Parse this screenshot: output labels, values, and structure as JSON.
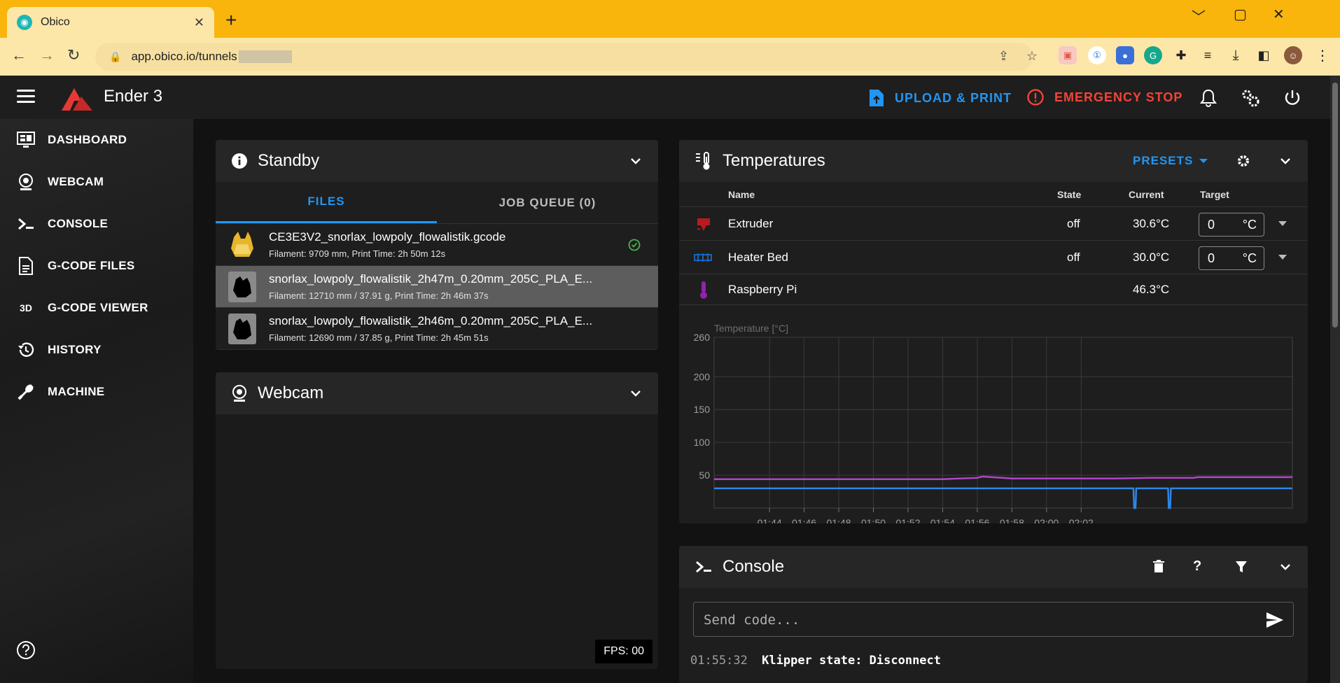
{
  "browser": {
    "tab_title": "Obico",
    "url": "app.obico.io/tunnels",
    "controls": {
      "minimize": "﹀",
      "restore": "▢",
      "close": "✕"
    }
  },
  "appbar": {
    "printer_name": "Ender 3",
    "upload_label": "UPLOAD & PRINT",
    "estop_label": "EMERGENCY STOP"
  },
  "sidebar": {
    "items": [
      {
        "label": "DASHBOARD",
        "icon": "monitor-dashboard-icon"
      },
      {
        "label": "WEBCAM",
        "icon": "webcam-icon"
      },
      {
        "label": "CONSOLE",
        "icon": "console-icon"
      },
      {
        "label": "G-CODE FILES",
        "icon": "file-document-icon"
      },
      {
        "label": "G-CODE VIEWER",
        "icon": "3d-icon"
      },
      {
        "label": "HISTORY",
        "icon": "history-icon"
      },
      {
        "label": "MACHINE",
        "icon": "wrench-icon"
      }
    ]
  },
  "status_card": {
    "title": "Standby",
    "tabs": {
      "files": "FILES",
      "job_queue": "JOB QUEUE (0)"
    },
    "files": [
      {
        "name": "CE3E3V2_snorlax_lowpoly_flowalistik.gcode",
        "meta": "Filament: 9709 mm, Print Time: 2h 50m 12s",
        "selected": false,
        "done": true
      },
      {
        "name": "snorlax_lowpoly_flowalistik_2h47m_0.20mm_205C_PLA_E...",
        "meta": "Filament: 12710 mm / 37.91 g, Print Time: 2h 46m 37s",
        "selected": true,
        "done": false
      },
      {
        "name": "snorlax_lowpoly_flowalistik_2h46m_0.20mm_205C_PLA_E...",
        "meta": "Filament: 12690 mm / 37.85 g, Print Time: 2h 45m 51s",
        "selected": false,
        "done": false
      }
    ]
  },
  "webcam_card": {
    "title": "Webcam",
    "fps": "FPS: 00"
  },
  "temperatures": {
    "title": "Temperatures",
    "presets_label": "PRESETS",
    "headers": {
      "name": "Name",
      "state": "State",
      "current": "Current",
      "target": "Target"
    },
    "rows": [
      {
        "name": "Extruder",
        "state": "off",
        "current": "30.6°C",
        "target": "0",
        "unit": "°C"
      },
      {
        "name": "Heater Bed",
        "state": "off",
        "current": "30.0°C",
        "target": "0",
        "unit": "°C"
      },
      {
        "name": "Raspberry Pi",
        "state": "",
        "current": "46.3°C"
      }
    ]
  },
  "chart_data": {
    "type": "line",
    "title": "",
    "ylabel": "Temperature [°C]",
    "ylim": [
      0,
      260
    ],
    "yticks": [
      50,
      100,
      150,
      200,
      260
    ],
    "xticks": [
      "01:44",
      "01:46",
      "01:48",
      "01:50",
      "01:52",
      "01:54",
      "01:56",
      "01:58",
      "02:00",
      "02:02"
    ],
    "grid": true,
    "x_minutes": [
      0,
      10,
      11,
      12,
      12.3,
      13.5,
      14,
      20,
      22,
      24.3,
      24.5,
      24.7,
      25,
      26,
      29
    ],
    "series": [
      {
        "color": "#b044c8",
        "values": [
          44,
          44,
          45,
          46,
          48,
          46,
          45,
          45,
          46,
          46,
          46,
          47,
          47,
          47,
          47
        ]
      },
      {
        "color": "#2e86e6",
        "values": [
          30,
          30,
          30,
          30,
          30,
          30,
          30,
          30,
          30,
          30,
          30,
          30,
          30,
          30,
          30
        ]
      }
    ],
    "dips_minutes": [
      21.1,
      23.1
    ],
    "x_range": [
      -3.2,
      30.2
    ]
  },
  "console_card": {
    "title": "Console",
    "placeholder": "Send code...",
    "lines": [
      {
        "time": "01:55:32",
        "msg": "Klipper state: Disconnect"
      }
    ]
  },
  "colors": {
    "accent": "#2196f3",
    "danger": "#f44336",
    "extruder": "#c62828",
    "bed": "#1565c0",
    "pi": "#8e24aa"
  }
}
